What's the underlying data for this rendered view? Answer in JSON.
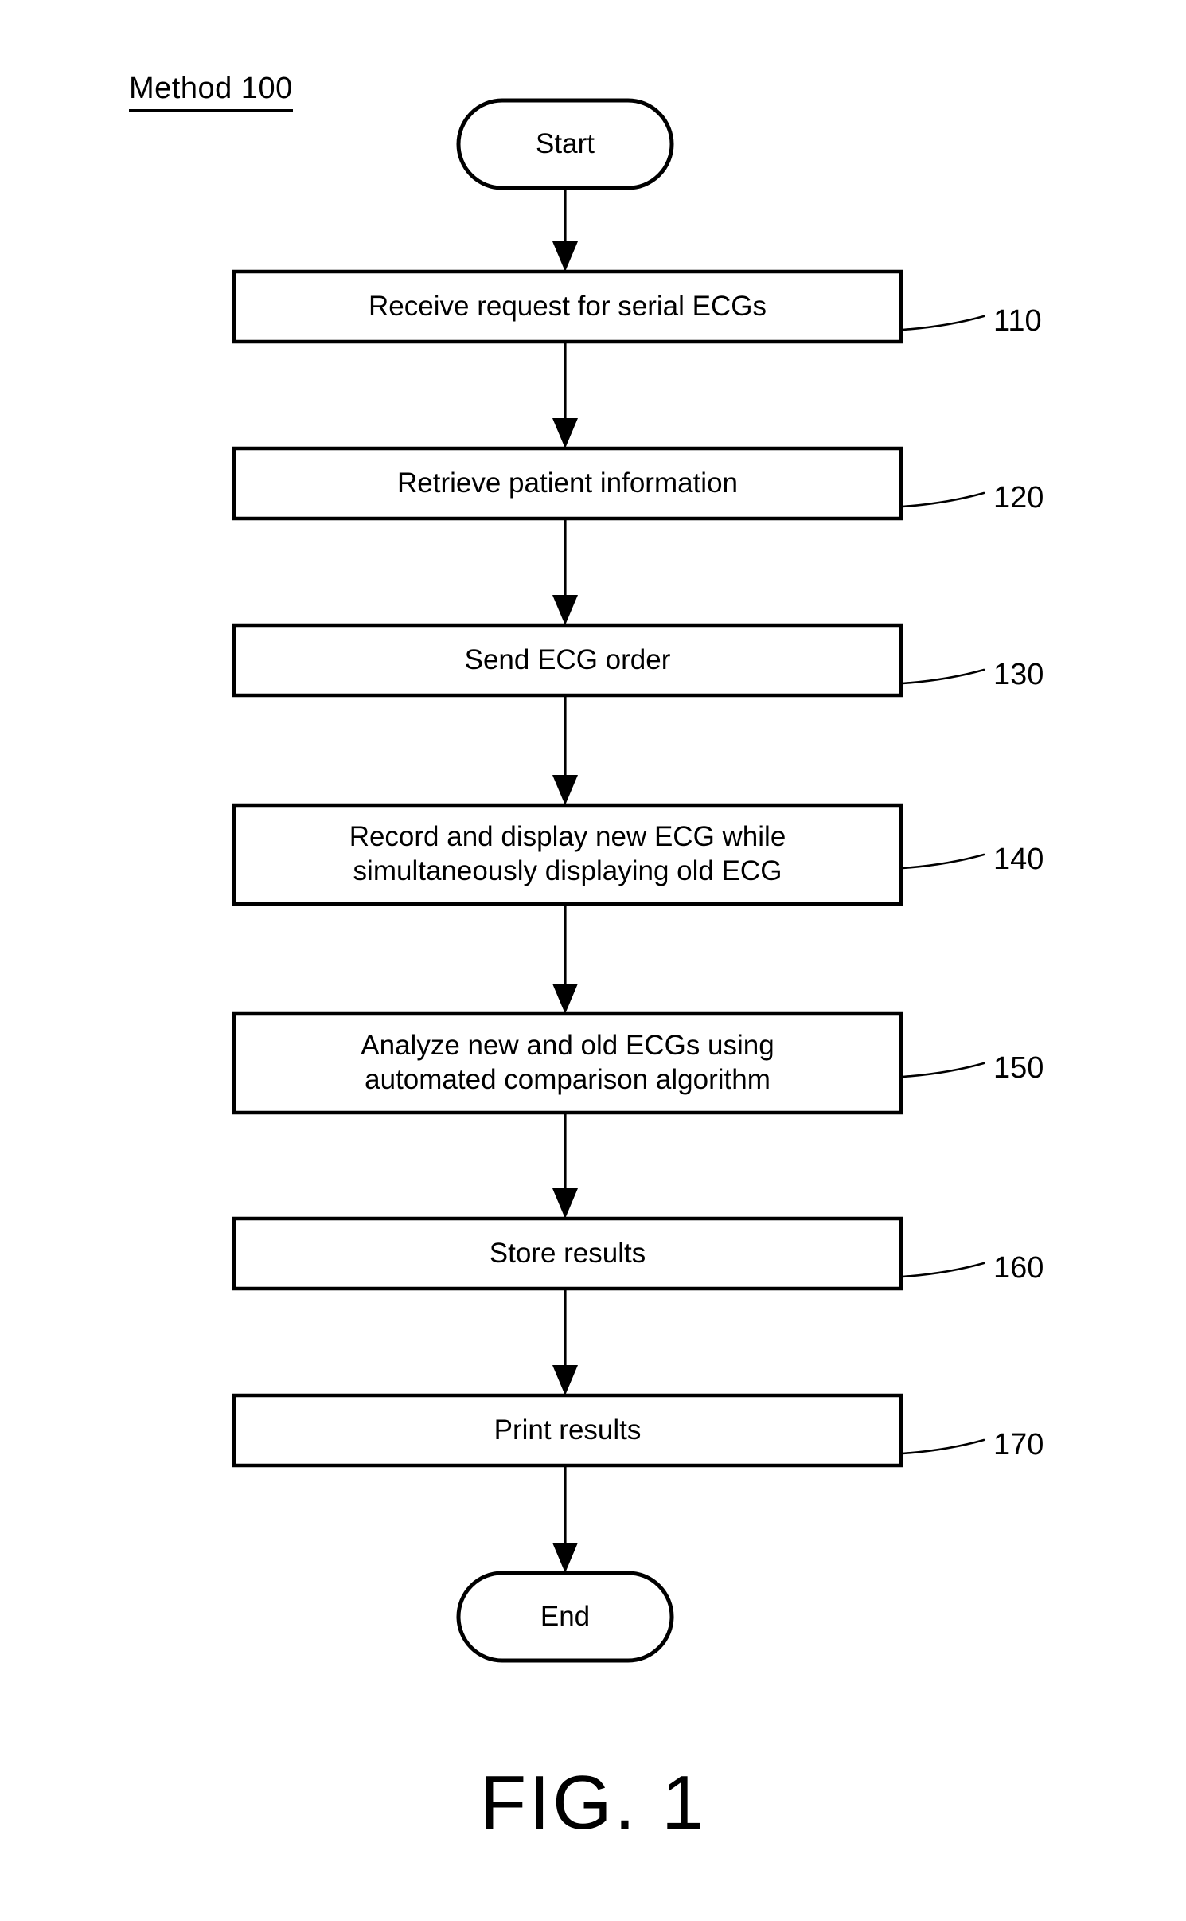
{
  "figure": {
    "label": "Method 100",
    "caption": "FIG. 1",
    "ink_color": "#000000",
    "background_color": "#ffffff"
  },
  "flowchart": {
    "start_node": {
      "label": "Start",
      "shape": "terminator"
    },
    "end_node": {
      "label": "End",
      "shape": "terminator"
    },
    "steps": [
      {
        "ref": "110",
        "label": "Receive request for serial ECGs",
        "shape": "process",
        "lines": 1
      },
      {
        "ref": "120",
        "label": "Retrieve patient information",
        "shape": "process",
        "lines": 1
      },
      {
        "ref": "130",
        "label": "Send ECG order",
        "shape": "process",
        "lines": 1
      },
      {
        "ref": "140",
        "label": "Record and display new ECG while\nsimultaneously displaying old ECG",
        "shape": "process",
        "lines": 2
      },
      {
        "ref": "150",
        "label": "Analyze new and old ECGs using\nautomated comparison algorithm",
        "shape": "process",
        "lines": 2
      },
      {
        "ref": "160",
        "label": "Store results",
        "shape": "process",
        "lines": 1
      },
      {
        "ref": "170",
        "label": "Print results",
        "shape": "process",
        "lines": 1
      }
    ]
  }
}
